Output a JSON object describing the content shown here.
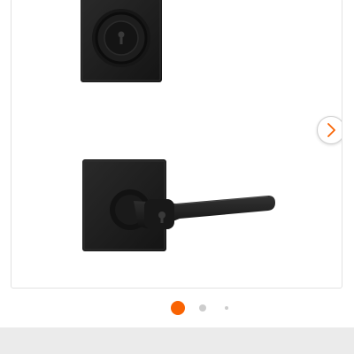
{
  "gallery": {
    "image_name": "deadbolt-and-lever-handle-set",
    "next_icon": "chevron-right-icon",
    "accent_color": "#f96302",
    "current_slide": 1,
    "dot_color": "#cdcdcd"
  }
}
